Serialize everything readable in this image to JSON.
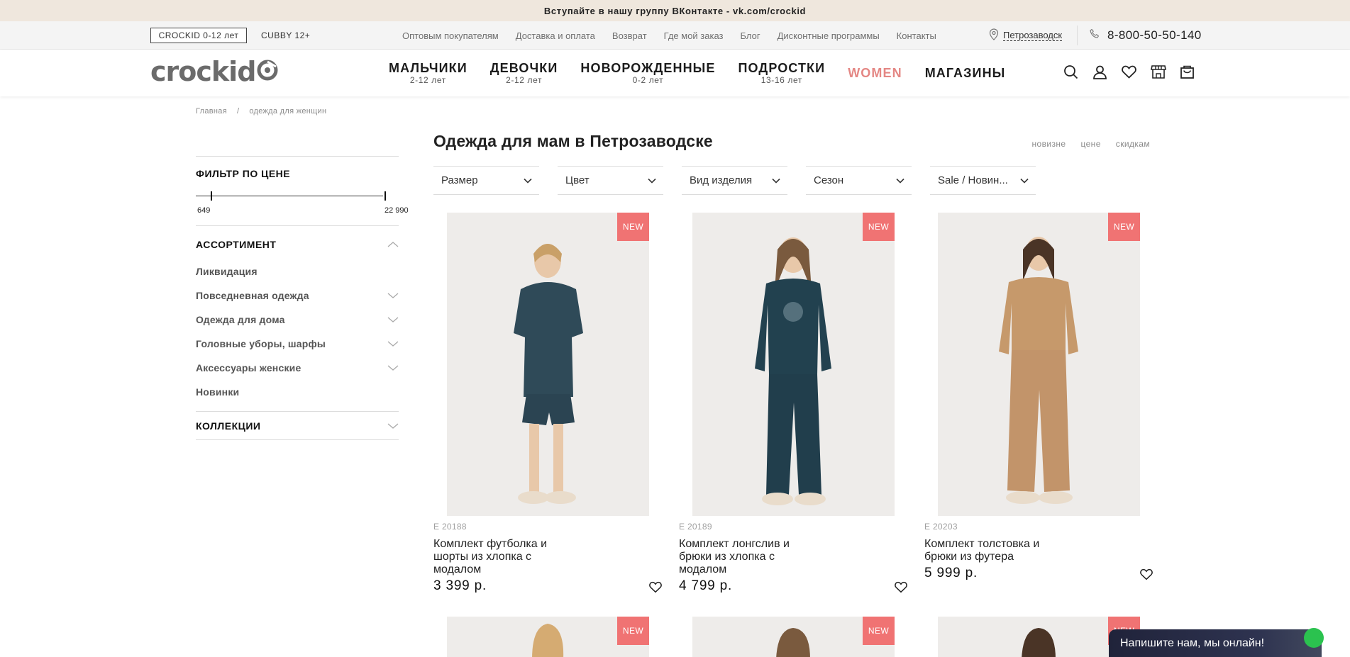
{
  "promo": {
    "text": "Вступайте в нашу группу ВКонтакте - vk.com/crockid"
  },
  "brand_tabs": {
    "active": "CROCKID 0-12 лет",
    "other": "CUBBY 12+"
  },
  "util_links": [
    "Оптовым покупателям",
    "Доставка и оплата",
    "Возврат",
    "Где мой заказ",
    "Блог",
    "Дисконтные программы",
    "Контакты"
  ],
  "location": {
    "city": "Петрозаводск"
  },
  "contact": {
    "phone": "8-800-50-50-140"
  },
  "logo": {
    "text": "crockid"
  },
  "nav": [
    {
      "label": "МАЛЬЧИКИ",
      "sub": "2-12 лет"
    },
    {
      "label": "ДЕВОЧКИ",
      "sub": "2-12 лет"
    },
    {
      "label": "НОВОРОЖДЕННЫЕ",
      "sub": "0-2 лет"
    },
    {
      "label": "ПОДРОСТКИ",
      "sub": "13-16 лет"
    },
    {
      "label": "WOMEN",
      "sub": ""
    },
    {
      "label": "МАГАЗИНЫ",
      "sub": ""
    }
  ],
  "accent_color": "#e48784",
  "badge_color": "#f07373",
  "breadcrumb": {
    "home": "Главная",
    "separator": "/",
    "current": "одежда для женщин"
  },
  "sidebar": {
    "price_title": "ФИЛЬТР ПО ЦЕНЕ",
    "price_min": "649",
    "price_max": "22 990",
    "assortment_title": "АССОРТИМЕНТ",
    "categories": [
      "Ликвидация",
      "Повседневная одежда",
      "Одежда для дома",
      "Головные уборы, шарфы",
      "Аксессуары женские",
      "Новинки"
    ],
    "collections_title": "КОЛЛЕКЦИИ"
  },
  "page": {
    "title": "Одежда для мам в Петрозаводске",
    "sort": [
      "новизне",
      "цене",
      "скидкам"
    ],
    "filters": [
      "Размер",
      "Цвет",
      "Вид изделия",
      "Сезон",
      "Sale / Новин..."
    ]
  },
  "products": [
    {
      "badge": "NEW",
      "sku": "E 20188",
      "name": "Комплект футболка и шорты из хлопка с модалом",
      "price": "3 399 р."
    },
    {
      "badge": "NEW",
      "sku": "E 20189",
      "name": "Комплект лонгслив и брюки из хлопка с модалом",
      "price": "4 799 р."
    },
    {
      "badge": "NEW",
      "sku": "E 20203",
      "name": "Комплект толстовка и брюки из футера",
      "price": "5 999 р."
    }
  ],
  "next_row_badges": [
    "NEW",
    "NEW",
    "NEW"
  ],
  "chat": {
    "text": "Напишите нам, мы онлайн!"
  }
}
